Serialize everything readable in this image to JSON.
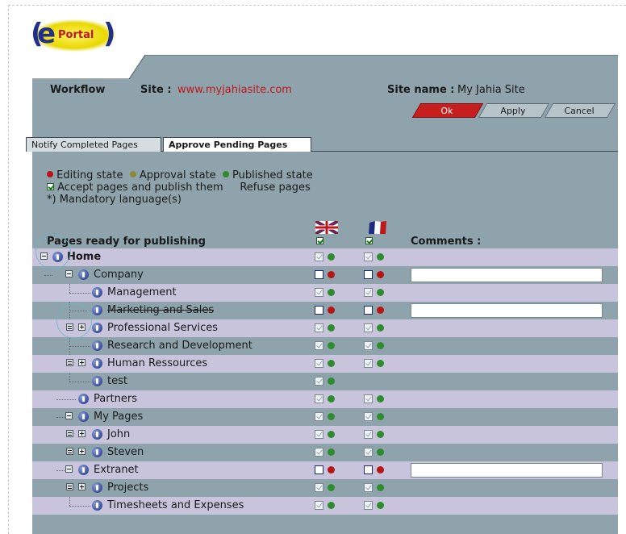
{
  "header": {
    "workflow_label": "Workflow",
    "site_label": "Site :",
    "site_url": "www.myjahiasite.com",
    "site_name_label": "Site name :",
    "site_name_value": "My Jahia Site"
  },
  "logo": {
    "text_e": "e",
    "text_portal": "Portal"
  },
  "buttons": {
    "ok": "Ok",
    "apply": "Apply",
    "cancel": "Cancel"
  },
  "tabs": [
    {
      "label": "Notify Completed Pages",
      "active": false
    },
    {
      "label": "Approve Pending Pages",
      "active": true
    }
  ],
  "legend": {
    "editing": "Editing state",
    "approval": "Approval state",
    "published": "Published state",
    "accept": "Accept pages and publish them",
    "refuse": "Refuse pages",
    "mandatory": "*) Mandatory language(s)"
  },
  "table": {
    "pages_header": "Pages ready for publishing",
    "comments_header": "Comments :",
    "languages": [
      "English",
      "French"
    ]
  },
  "rows": [
    {
      "label": "Home",
      "en": "check-green",
      "fr": "check-green",
      "comment": false
    },
    {
      "label": "Company",
      "en": "box-red",
      "fr": "box-red",
      "comment": true
    },
    {
      "label": "Management",
      "en": "check-green",
      "fr": "check-green",
      "comment": false
    },
    {
      "label": "Marketing and Sales",
      "en": "box-red",
      "fr": "box-red",
      "comment": true
    },
    {
      "label": "Professional Services",
      "en": "check-green",
      "fr": "check-green",
      "comment": false
    },
    {
      "label": "Research and Development",
      "en": "check-green",
      "fr": "check-green",
      "comment": false
    },
    {
      "label": "Human Ressources",
      "en": "check-green",
      "fr": "check-green",
      "comment": false
    },
    {
      "label": "test",
      "en": "check-green",
      "fr": "",
      "comment": false
    },
    {
      "label": "Partners",
      "en": "check-green",
      "fr": "check-green",
      "comment": false
    },
    {
      "label": "My Pages",
      "en": "check-green",
      "fr": "check-green",
      "comment": false
    },
    {
      "label": "John",
      "en": "check-green",
      "fr": "check-green",
      "comment": false
    },
    {
      "label": "Steven",
      "en": "check-green",
      "fr": "check-green",
      "comment": false
    },
    {
      "label": "Extranet",
      "en": "box-red",
      "fr": "box-red",
      "comment": true
    },
    {
      "label": "Projects",
      "en": "check-green",
      "fr": "check-green",
      "comment": false
    },
    {
      "label": "Timesheets and Expenses",
      "en": "check-green",
      "fr": "check-green",
      "comment": false
    }
  ],
  "colors": {
    "panel": "#8ea3ac",
    "row_alt": "#c7c4dc",
    "editing": "#b81414",
    "approval": "#8c8a3a",
    "published": "#2e8c2e",
    "ok_button": "#c71e1e"
  }
}
